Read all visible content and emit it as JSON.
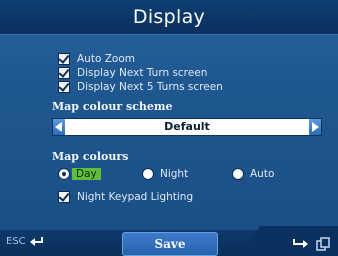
{
  "header": {
    "title": "Display"
  },
  "options": [
    {
      "label": "Auto Zoom",
      "checked": true
    },
    {
      "label": "Display Next Turn screen",
      "checked": true
    },
    {
      "label": "Display Next 5 Turns screen",
      "checked": true
    }
  ],
  "colour_scheme": {
    "section_label": "Map colour scheme",
    "selected": "Default"
  },
  "map_colours": {
    "section_label": "Map colours",
    "choices": [
      {
        "label": "Day",
        "selected": true
      },
      {
        "label": "Night",
        "selected": false
      },
      {
        "label": "Auto",
        "selected": false
      }
    ]
  },
  "keypad_lighting": {
    "label": "Night Keypad Lighting",
    "checked": true
  },
  "footer": {
    "esc_label": "ESC",
    "save_label": "Save"
  },
  "colors": {
    "background": "#1f5890",
    "title_bar": "#0b3566",
    "highlight": "#5fbe3c",
    "button": "#2c6cb8"
  }
}
